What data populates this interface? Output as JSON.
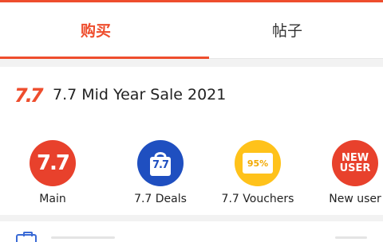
{
  "tabs": [
    {
      "label": "购买"
    },
    {
      "label": "帖子"
    }
  ],
  "sale": {
    "logo_text": "7.7",
    "title": "7.7 Mid Year Sale 2021"
  },
  "shortcuts": [
    {
      "label": "Main",
      "icon_text": "7.7",
      "color": "#e8412c"
    },
    {
      "label": "7.7 Deals",
      "icon_text": "7.7",
      "color": "#1f4fc0"
    },
    {
      "label": "7.7 Vouchers",
      "icon_text": "95%",
      "color": "#ffc21a"
    },
    {
      "label": "New user",
      "icon_text": "NEW USER",
      "color": "#e8412c"
    }
  ],
  "accent_color": "#ee4d2d"
}
